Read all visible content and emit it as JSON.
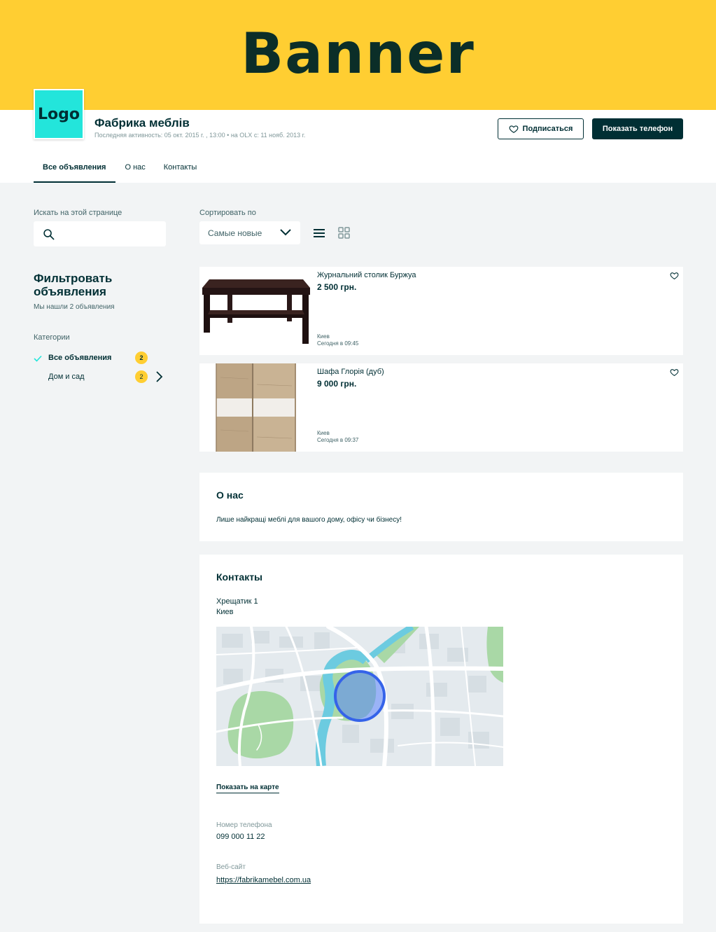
{
  "banner": {
    "text": "Banner"
  },
  "header": {
    "logo_text": "Logo",
    "company_name": "Фабрика меблів",
    "activity": "Последняя активность: 05 окт. 2015 г. , 13:00   •   на OLX с: 11 нояб. 2013 г.",
    "subscribe_label": "Подписаться",
    "phone_label": "Показать телефон"
  },
  "tabs": [
    {
      "label": "Все объявления",
      "active": true
    },
    {
      "label": "О нас",
      "active": false
    },
    {
      "label": "Контакты",
      "active": false
    }
  ],
  "search": {
    "label": "Искать на этой странице",
    "value": ""
  },
  "sort": {
    "label": "Сортировать по",
    "selected": "Самые новые"
  },
  "filter": {
    "title": "Фильтровать объявления",
    "found": "Мы нашли 2 объявления",
    "categories_label": "Категории",
    "categories": [
      {
        "name": "Все объявления",
        "count": "2",
        "selected": true
      },
      {
        "name": "Дом и сад",
        "count": "2",
        "selected": false
      }
    ]
  },
  "listings": [
    {
      "title": "Журнальний столик Буржуа",
      "price": "2 500 грн.",
      "city": "Киев",
      "date": "Сегодня в 09:45"
    },
    {
      "title": "Шафа Глорія (дуб)",
      "price": "9 000 грн.",
      "city": "Киев",
      "date": "Сегодня в 09:37"
    }
  ],
  "about": {
    "title": "О нас",
    "text": "Лише найкращі меблі для вашого дому, офісу чи бізнесу!"
  },
  "contacts": {
    "title": "Контакты",
    "street": "Хрещатик 1",
    "city": "Киев",
    "show_map": "Показать на карте",
    "phone_label": "Номер телефона",
    "phone": "099 000 11 22",
    "website_label": "Веб-сайт",
    "website": "https://fabrikamebel.com.ua"
  },
  "colors": {
    "banner": "#ffce32",
    "logo": "#23e5db",
    "primary": "#002f34",
    "background": "#f2f4f5"
  }
}
